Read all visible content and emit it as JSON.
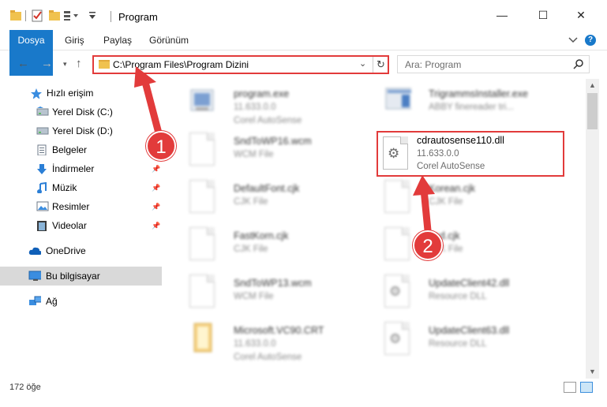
{
  "window": {
    "title": "Program",
    "controls": {
      "minimize": "—",
      "maximize": "☐",
      "close": "✕"
    }
  },
  "ribbon": {
    "tabs": [
      "Dosya",
      "Giriş",
      "Paylaş",
      "Görünüm"
    ],
    "expand_icon": "chevron-down-icon",
    "help": "?"
  },
  "address": {
    "path": "C:\\Program Files\\Program Dizini",
    "search_placeholder": "Ara: Program"
  },
  "nav": {
    "items": [
      {
        "label": "Hızlı erişim",
        "icon": "star-icon",
        "pinned": false
      },
      {
        "label": "Yerel Disk (C:)",
        "icon": "drive-icon",
        "pinned": false
      },
      {
        "label": "Yerel Disk (D:)",
        "icon": "drive-icon",
        "pinned": false
      },
      {
        "label": "Belgeler",
        "icon": "documents-icon",
        "pinned": true
      },
      {
        "label": "İndirmeler",
        "icon": "download-icon",
        "pinned": true
      },
      {
        "label": "Müzik",
        "icon": "music-icon",
        "pinned": true
      },
      {
        "label": "Resimler",
        "icon": "pictures-icon",
        "pinned": true
      },
      {
        "label": "Videolar",
        "icon": "videos-icon",
        "pinned": true
      },
      {
        "label": "OneDrive",
        "icon": "cloud-icon",
        "pinned": false
      },
      {
        "label": "Bu bilgisayar",
        "icon": "computer-icon",
        "pinned": false,
        "selected": true
      },
      {
        "label": "Ağ",
        "icon": "network-icon",
        "pinned": false
      }
    ]
  },
  "files": [
    {
      "name": "program.exe",
      "line1": "11.633.0.0",
      "line2": "Corel AutoSense",
      "blurred": true
    },
    {
      "name": "TrigrammsInstaller.exe",
      "line1": "ABBY finereader tri...",
      "line2": "",
      "blurred": true
    },
    {
      "name": "SndToWP16.wcm",
      "line1": "WCM File",
      "line2": "",
      "blurred": true
    },
    {
      "name": "cdrautosense110.dll",
      "line1": "11.633.0.0",
      "line2": "Corel AutoSense",
      "blurred": false
    },
    {
      "name": "DefaultFont.cjk",
      "line1": "CJK File",
      "line2": "",
      "blurred": true
    },
    {
      "name": "Korean.cjk",
      "line1": "CJK File",
      "line2": "",
      "blurred": true
    },
    {
      "name": "FastKorn.cjk",
      "line1": "CJK File",
      "line2": "",
      "blurred": true
    },
    {
      "name": "bad.cjk",
      "line1": "CJK File",
      "line2": "",
      "blurred": true
    },
    {
      "name": "SndToWP13.wcm",
      "line1": "WCM File",
      "line2": "",
      "blurred": true
    },
    {
      "name": "UpdateClient42.dll",
      "line1": "Resource DLL",
      "line2": "",
      "blurred": true
    },
    {
      "name": "Microsoft.VC90.CRT",
      "line1": "11.633.0.0",
      "line2": "Corel AutoSense",
      "blurred": true
    },
    {
      "name": "UpdateClient63.dll",
      "line1": "Resource DLL",
      "line2": "",
      "blurred": true
    }
  ],
  "status": {
    "count": "172 öğe"
  },
  "annotations": {
    "step1": "1",
    "step2": "2",
    "color": "#e23b3b"
  }
}
